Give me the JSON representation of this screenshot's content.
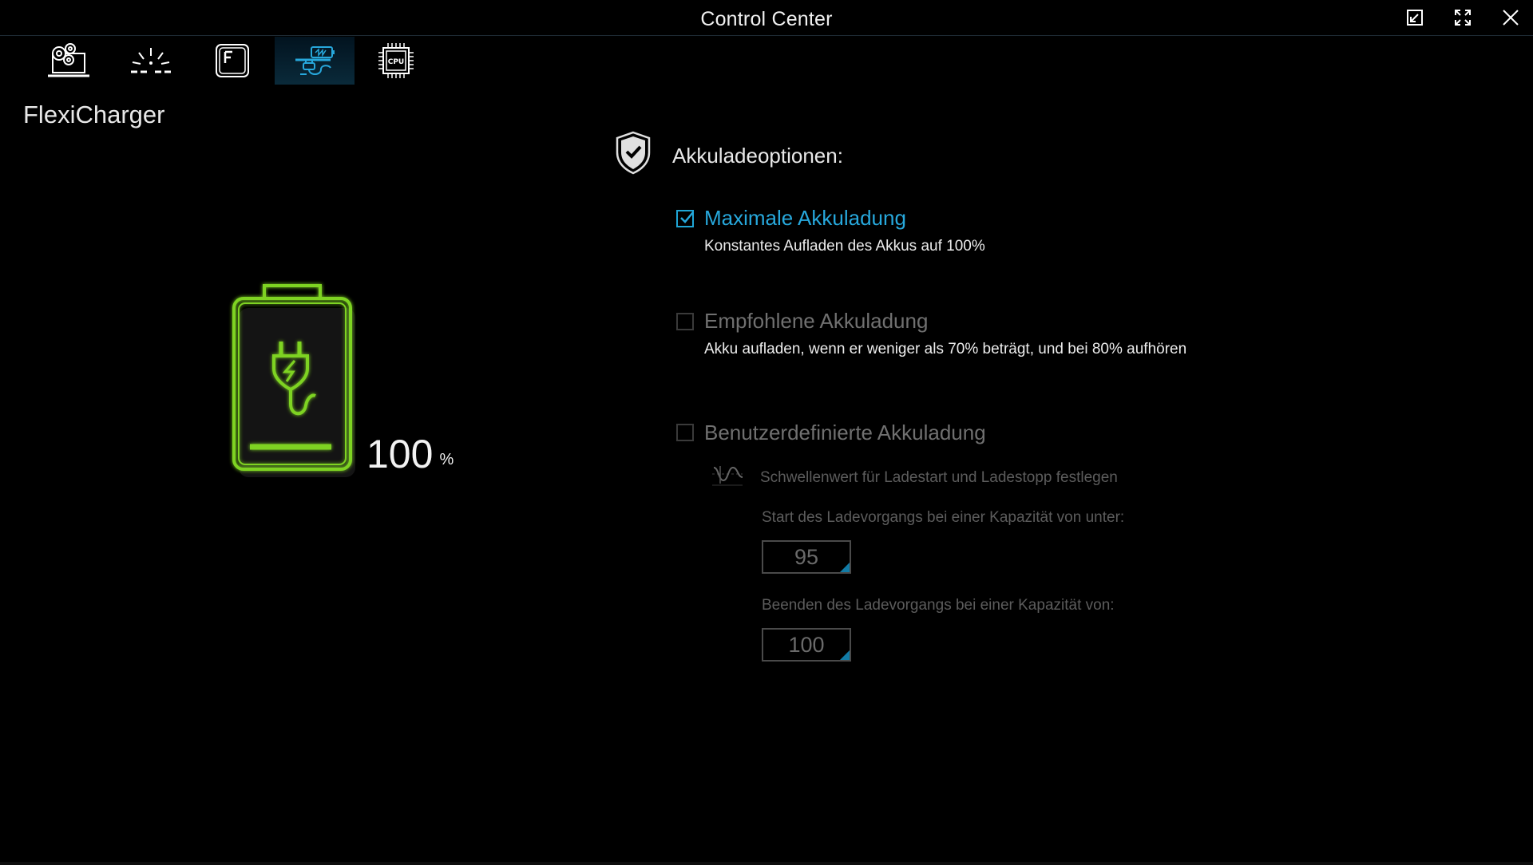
{
  "window": {
    "title": "Control Center",
    "buttons": [
      "restore-icon",
      "fullscreen-icon",
      "close-icon"
    ]
  },
  "tabs": [
    {
      "icon": "system-settings-icon",
      "active": false
    },
    {
      "icon": "lighting-icon",
      "active": false
    },
    {
      "icon": "function-key-icon",
      "active": false
    },
    {
      "icon": "flexicharger-icon",
      "active": true
    },
    {
      "icon": "cpu-icon",
      "active": false
    }
  ],
  "page": {
    "title": "FlexiCharger"
  },
  "battery": {
    "level": "100",
    "unit": "%",
    "color": "#7ed321"
  },
  "options": {
    "header": "Akkuladeoptionen:",
    "items": [
      {
        "label": "Maximale Akkuladung",
        "description": "Konstantes Aufladen des Akkus auf 100%",
        "checked": true
      },
      {
        "label": "Empfohlene Akkuladung",
        "description": "Akku aufladen, wenn er weniger als 70% beträgt, und bei 80% aufhören",
        "checked": false
      },
      {
        "label": "Benutzerdefinierte Akkuladung",
        "checked": false
      }
    ],
    "custom": {
      "threshold_label": "Schwellenwert für Ladestart und Ladestopp festlegen",
      "start_label": "Start des Ladevorgangs bei einer Kapazität von unter:",
      "start_value": "95",
      "stop_label": "Beenden des Ladevorgangs bei einer Kapazität von:",
      "stop_value": "100"
    }
  },
  "colors": {
    "accent": "#27a8dc",
    "battery_green": "#7ed321",
    "background": "#000000"
  }
}
